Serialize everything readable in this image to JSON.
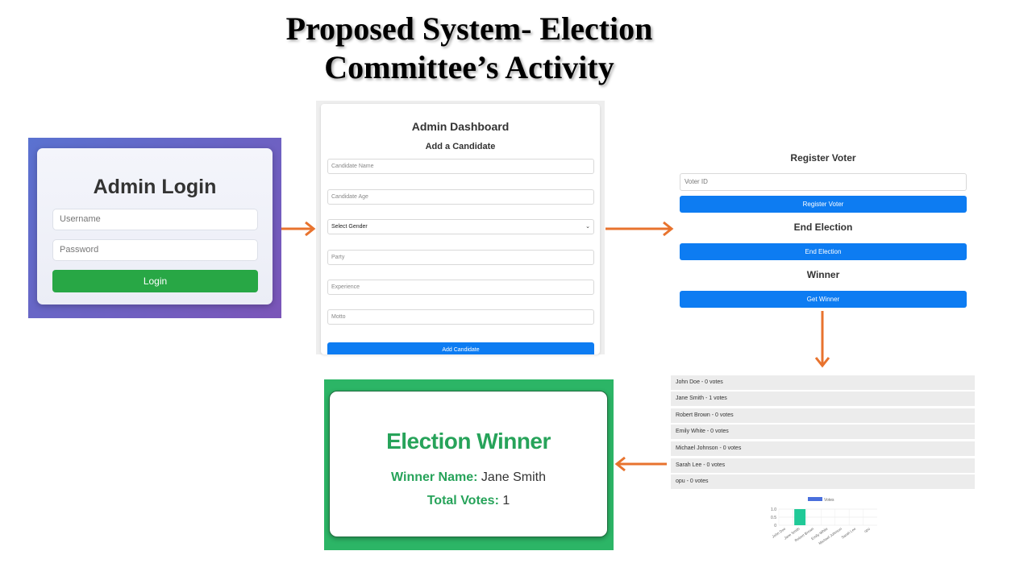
{
  "slide": {
    "title_line1": "Proposed System- Election",
    "title_line2": "Committee’s Activity"
  },
  "login": {
    "title": "Admin Login",
    "username_placeholder": "Username",
    "password_placeholder": "Password",
    "button": "Login"
  },
  "dashboard": {
    "title": "Admin Dashboard",
    "subtitle": "Add a Candidate",
    "fields": [
      "Candidate Name",
      "Candidate Age",
      "Select Gender",
      "Party",
      "Experience",
      "Motto"
    ],
    "button": "Add Candidate"
  },
  "register": {
    "heading": "Register Voter",
    "voter_placeholder": "Voter ID",
    "register_button": "Register Voter",
    "end_heading": "End Election",
    "end_button": "End Election",
    "winner_heading": "Winner",
    "winner_button": "Get Winner"
  },
  "results": [
    "John Doe - 0 votes",
    "Jane Smith - 1 votes",
    "Robert Brown - 0 votes",
    "Emily White - 0 votes",
    "Michael Johnson - 0 votes",
    "Sarah Lee - 0 votes",
    "opu - 0 votes"
  ],
  "chart_data": {
    "type": "bar",
    "categories": [
      "John Doe",
      "Jane Smith",
      "Robert Brown",
      "Emily White",
      "Michael Johnson",
      "Sarah Lee",
      "opu"
    ],
    "series": [
      {
        "name": "Votes",
        "values": [
          0,
          1,
          0,
          0,
          0,
          0,
          0
        ]
      }
    ],
    "ytick_labels": [
      "1.0",
      "0.5",
      "0"
    ],
    "ylim": [
      0,
      1
    ],
    "legend": "top",
    "bar_color": "#20c997"
  },
  "winner": {
    "title": "Election Winner",
    "name_label": "Winner Name:",
    "name_value": "Jane Smith",
    "votes_label": "Total Votes:",
    "votes_value": "1"
  },
  "colors": {
    "arrow": "#e8732e",
    "primary": "#0d7cf2",
    "success": "#28a745",
    "winner_green": "#27a35a"
  }
}
